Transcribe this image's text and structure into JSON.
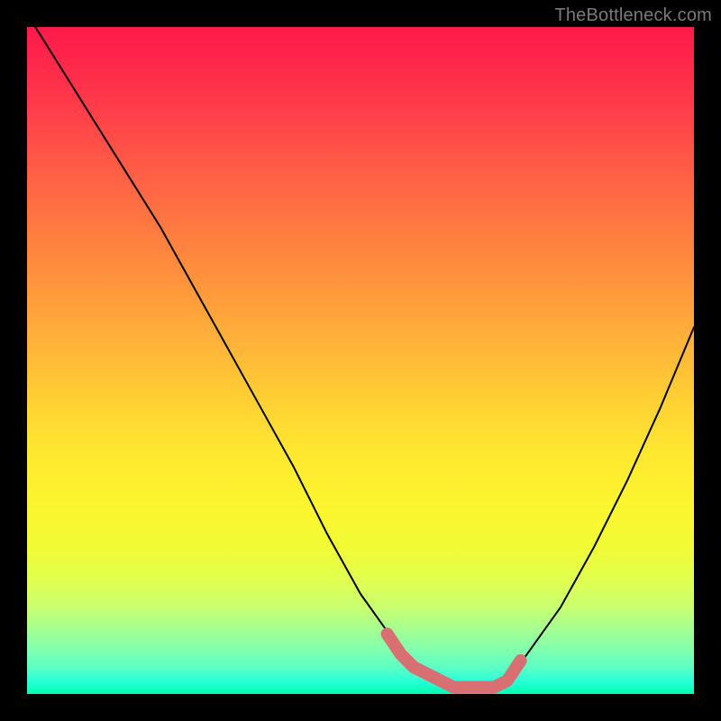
{
  "watermark": "TheBottleneck.com",
  "chart_data": {
    "type": "line",
    "title": "",
    "xlabel": "",
    "ylabel": "",
    "xlim": [
      0,
      100
    ],
    "ylim": [
      0,
      100
    ],
    "series": [
      {
        "name": "curve",
        "color": "#000000",
        "x": [
          0,
          5,
          10,
          15,
          20,
          25,
          30,
          35,
          40,
          45,
          50,
          55,
          60,
          65,
          70,
          72,
          75,
          80,
          85,
          90,
          95,
          100
        ],
        "values": [
          102,
          94,
          86,
          78,
          70,
          61,
          52,
          43,
          34,
          24,
          15,
          8,
          3,
          1,
          1,
          2,
          6,
          13,
          22,
          32,
          43,
          55
        ]
      },
      {
        "name": "highlight-band",
        "color": "#d86f73",
        "x": [
          54,
          56,
          58,
          60,
          62,
          64,
          66,
          68,
          70,
          72,
          74
        ],
        "values": [
          9,
          6,
          4,
          3,
          2,
          1,
          1,
          1,
          1,
          2,
          5
        ]
      }
    ],
    "annotations": []
  }
}
